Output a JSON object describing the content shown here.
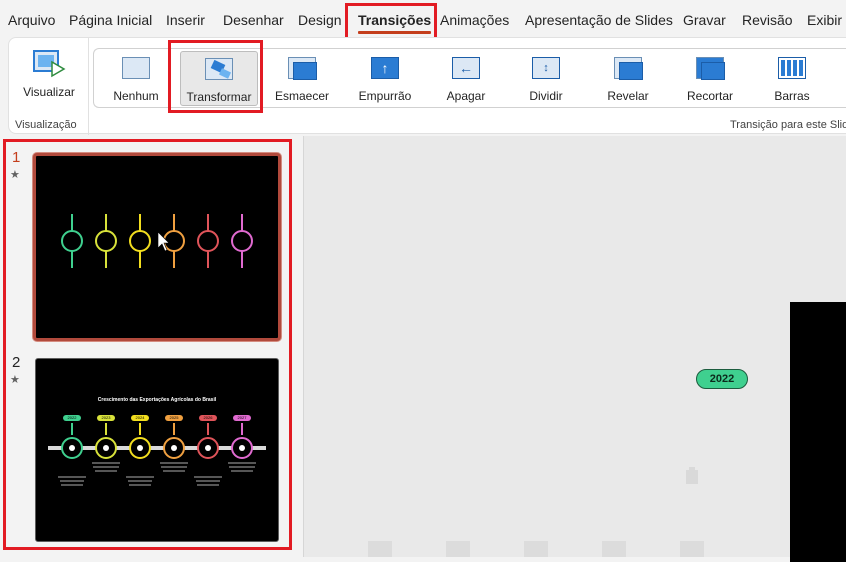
{
  "menu": {
    "tabs": [
      "Arquivo",
      "Página Inicial",
      "Inserir",
      "Desenhar",
      "Design",
      "Transições",
      "Animações",
      "Apresentação de Slides",
      "Gravar",
      "Revisão",
      "Exibir"
    ],
    "active": "Transições"
  },
  "ribbon": {
    "preview_label": "Visualizar",
    "preview_group_label": "Visualização",
    "transitions_group_label": "Transição para este Slide",
    "transitions": [
      "Nenhum",
      "Transformar",
      "Esmaecer",
      "Empurrão",
      "Apagar",
      "Dividir",
      "Revelar",
      "Recortar",
      "Barras"
    ],
    "selected_transition": "Transformar"
  },
  "slides": [
    {
      "number": "1",
      "marker": "★",
      "selected": true
    },
    {
      "number": "2",
      "marker": "★",
      "selected": false,
      "title": "Crescimento das Exportações Agrícolas do Brasil",
      "years": [
        "2022",
        "2023",
        "2024",
        "2025",
        "2026",
        "2027"
      ]
    }
  ],
  "canvas": {
    "badge": "2022"
  },
  "colors": {
    "accent": "#c43e1c",
    "highlight_box": "#e21b23",
    "circles": [
      "#3fd08f",
      "#d8e23a",
      "#f2de1f",
      "#f0a040",
      "#e0545a",
      "#e06ad0"
    ]
  }
}
